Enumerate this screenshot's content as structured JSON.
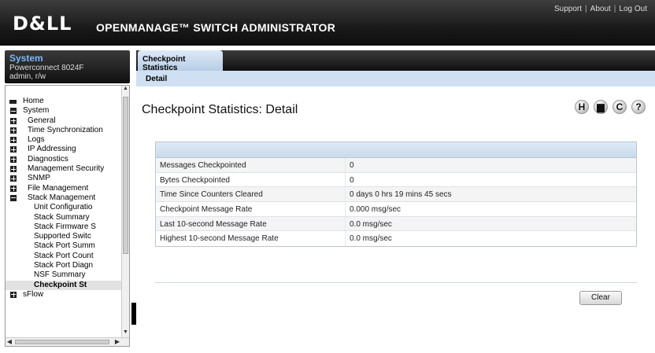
{
  "header": {
    "logo": "D&LL",
    "title": "OPENMANAGE™ SWITCH ADMINISTRATOR",
    "links": [
      "Support",
      "About",
      "Log Out"
    ],
    "separator": "|"
  },
  "system": {
    "title": "System",
    "device": "Powerconnect 8024F",
    "user": "admin, r/w"
  },
  "nav": {
    "items": [
      {
        "label": "Home"
      },
      {
        "label": "System"
      },
      {
        "label": "General"
      },
      {
        "label": "Time Synchronization"
      },
      {
        "label": "Logs"
      },
      {
        "label": "IP Addressing"
      },
      {
        "label": "Diagnostics"
      },
      {
        "label": "Management Security"
      },
      {
        "label": "SNMP"
      },
      {
        "label": "File Management"
      },
      {
        "label": "Stack Management"
      },
      {
        "label": "Unit Configuratio"
      },
      {
        "label": "Stack Summary"
      },
      {
        "label": "Stack Firmware S"
      },
      {
        "label": "Supported Switc"
      },
      {
        "label": "Stack Port Summ"
      },
      {
        "label": "Stack Port Count"
      },
      {
        "label": "Stack Port Diagn"
      },
      {
        "label": "NSF Summary"
      },
      {
        "label": "Checkpoint St"
      },
      {
        "label": "sFlow"
      }
    ],
    "selected": "Checkpoint St"
  },
  "tabs": {
    "active": "Checkpoint Statistics",
    "sub": "Detail"
  },
  "page": {
    "title": "Checkpoint Statistics: Detail",
    "toolbar_icons": [
      "save-icon",
      "print-icon",
      "refresh-icon",
      "help-icon"
    ],
    "toolbar_glyphs": [
      "H",
      "▆",
      "C",
      "?"
    ]
  },
  "table": {
    "rows": [
      {
        "label": "Messages Checkpointed",
        "value": "0"
      },
      {
        "label": "Bytes Checkpointed",
        "value": "0"
      },
      {
        "label": "Time Since Counters Cleared",
        "value": "0 days 0 hrs 19 mins 45 secs"
      },
      {
        "label": "Checkpoint Message Rate",
        "value": "0.000 msg/sec"
      },
      {
        "label": "Last 10-second Message Rate",
        "value": "0.0 msg/sec"
      },
      {
        "label": "Highest 10-second Message Rate",
        "value": "0.0 msg/sec"
      }
    ]
  },
  "actions": {
    "clear": "Clear"
  }
}
